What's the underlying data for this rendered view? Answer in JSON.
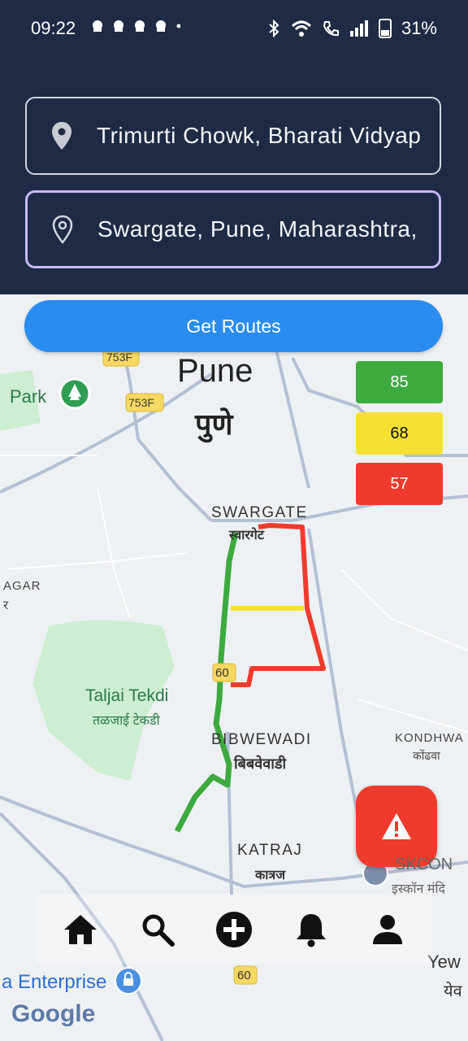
{
  "status_bar": {
    "time": "09:22",
    "notif_icons": "•",
    "battery": "31%"
  },
  "search": {
    "origin_value": "Trimurti Chowk, Bharati Vidyap",
    "destination_value": "Swargate, Pune, Maharashtra,"
  },
  "actions": {
    "get_routes_label": "Get Routes"
  },
  "route_scores": [
    "85",
    "68",
    "57"
  ],
  "map_labels": {
    "city_en": "Pune",
    "city_mr": "पुणे",
    "park": "Park",
    "road_753f_a": "753F",
    "road_753f_b": "753F",
    "swargate_en": "SWARGATE",
    "swargate_mr": "स्वारगेट",
    "agar": "AGAR",
    "agar_mr": "र",
    "taljai_en": "Taljai Tekdi",
    "taljai_mr": "तळजाई टेकडी",
    "road_60_a": "60",
    "road_60_b": "60",
    "bibwewadi_en": "BIBWEWADI",
    "bibwewadi_mr": "बिबवेवाडी",
    "kondhwa_en": "KONDHWA",
    "kondhwa_mr": "कोंढवा",
    "katraj_en": "KATRAJ",
    "katraj_mr": "कात्रज",
    "iskcon_en": "SKCON",
    "iskcon_mr": "इस्कॉन मंदि",
    "enterprise": "a Enterprise",
    "yew": "Yew",
    "yew_mr": "येव",
    "google": "Google"
  },
  "colors": {
    "header_bg": "#1f2a44",
    "button_blue": "#2a8cf0",
    "route_green": "#3daa3f",
    "route_yellow": "#f5e132",
    "route_red": "#ef3b2d"
  },
  "nav": {
    "icons": [
      "home-icon",
      "search-icon",
      "add-icon",
      "bell-icon",
      "profile-icon"
    ]
  }
}
